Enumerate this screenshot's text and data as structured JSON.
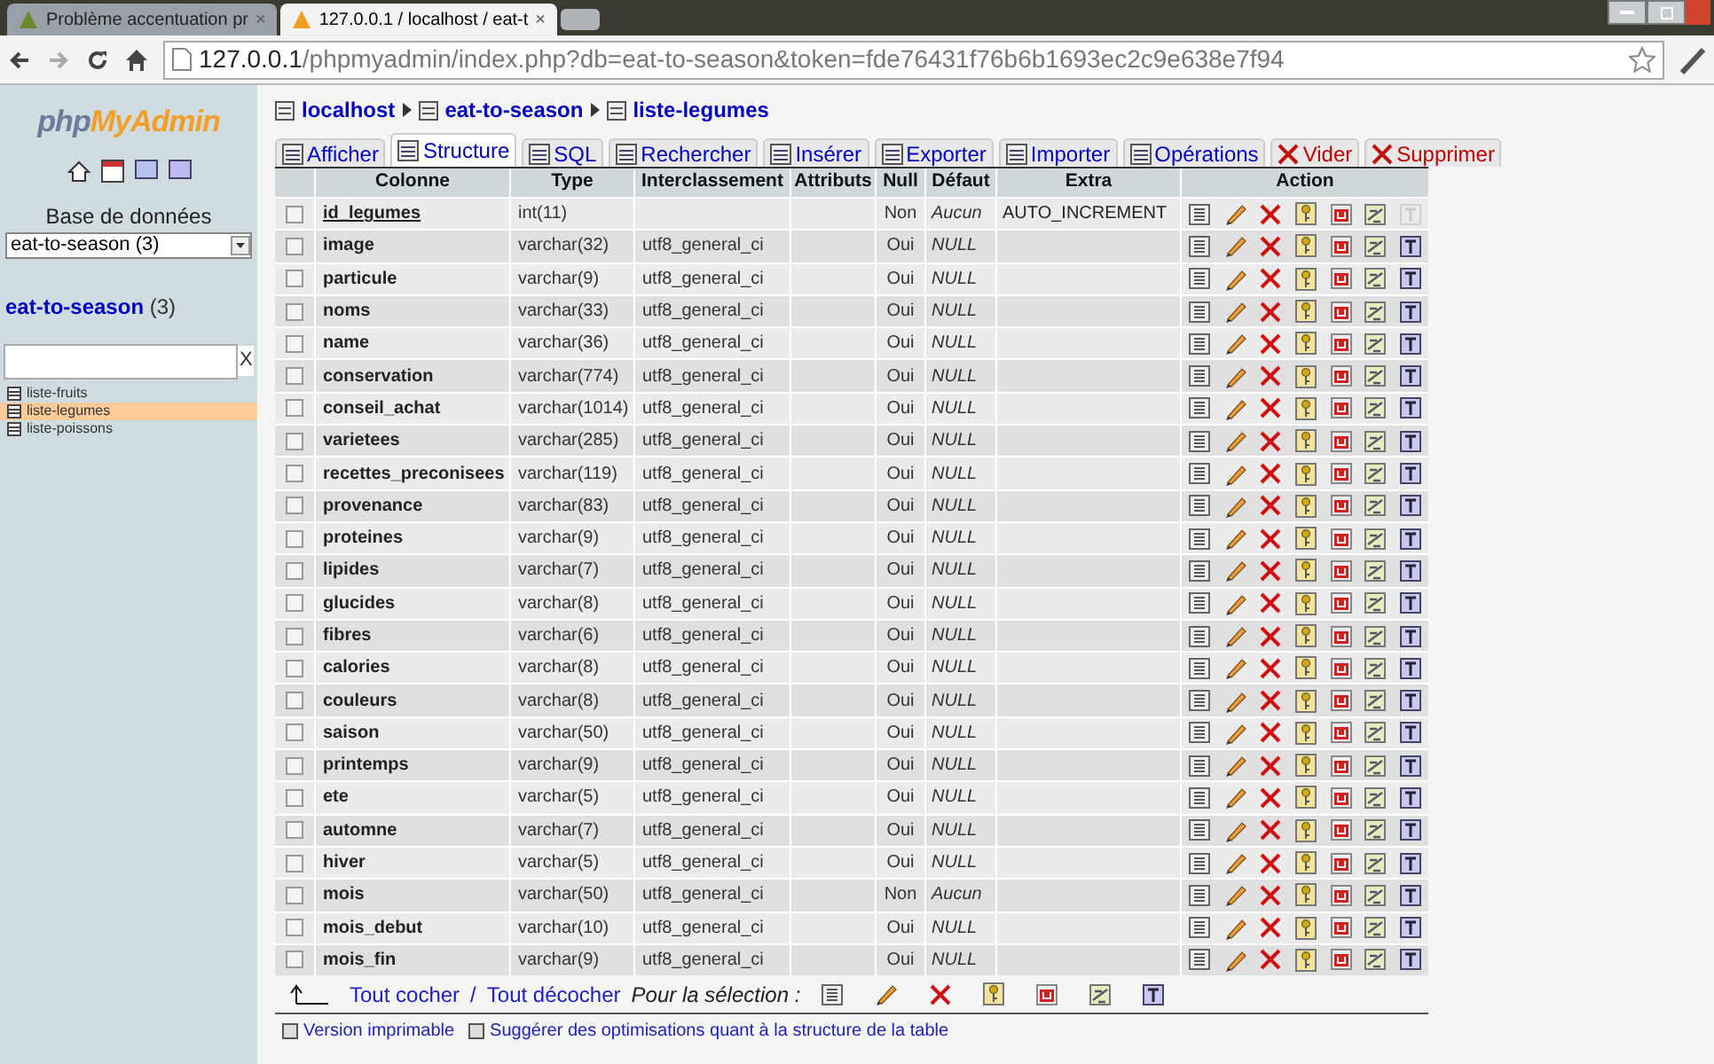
{
  "browser": {
    "tabs": [
      {
        "title": "Problème accentuation pr",
        "selected": false,
        "close": "×"
      },
      {
        "title": "127.0.0.1 / localhost / eat-t",
        "selected": true,
        "close": "×"
      }
    ],
    "url": {
      "host": "127.0.0.1",
      "path": "/phpmyadmin/index.php?db=eat-to-season&token=fde76431f76b6b1693ec2c9e638e7f94"
    }
  },
  "sidebar": {
    "logo": {
      "part1": "php",
      "part2": "MyAdmin"
    },
    "db_label": "Base de données",
    "db_select": "eat-to-season (3)",
    "db_link": "eat-to-season",
    "db_count": "(3)",
    "filter_clear": "X",
    "tables": [
      {
        "name": "liste-fruits",
        "selected": false
      },
      {
        "name": "liste-legumes",
        "selected": true
      },
      {
        "name": "liste-poissons",
        "selected": false
      }
    ]
  },
  "breadcrumb": [
    "localhost",
    "eat-to-season",
    "liste-legumes"
  ],
  "tabs": [
    {
      "label": "Afficher",
      "selected": false,
      "kind": "normal"
    },
    {
      "label": "Structure",
      "selected": true,
      "kind": "normal"
    },
    {
      "label": "SQL",
      "selected": false,
      "kind": "normal"
    },
    {
      "label": "Rechercher",
      "selected": false,
      "kind": "normal"
    },
    {
      "label": "Insérer",
      "selected": false,
      "kind": "normal"
    },
    {
      "label": "Exporter",
      "selected": false,
      "kind": "normal"
    },
    {
      "label": "Importer",
      "selected": false,
      "kind": "normal"
    },
    {
      "label": "Opérations",
      "selected": false,
      "kind": "normal"
    },
    {
      "label": "Vider",
      "selected": false,
      "kind": "danger"
    },
    {
      "label": "Supprimer",
      "selected": false,
      "kind": "danger"
    }
  ],
  "table": {
    "columns": [
      "Colonne",
      "Type",
      "Interclassement",
      "Attributs",
      "Null",
      "Défaut",
      "Extra",
      "Action"
    ],
    "rows": [
      {
        "name": "id_legumes",
        "type": "int(11)",
        "collation": "",
        "null": "Non",
        "default": "Aucun",
        "extra": "AUTO_INCREMENT",
        "primary": true,
        "checked": false
      },
      {
        "name": "image",
        "type": "varchar(32)",
        "collation": "utf8_general_ci",
        "null": "Oui",
        "default": "NULL",
        "primary": false,
        "checked": false
      },
      {
        "name": "particule",
        "type": "varchar(9)",
        "collation": "utf8_general_ci",
        "null": "Oui",
        "default": "NULL",
        "primary": false,
        "checked": false
      },
      {
        "name": "noms",
        "type": "varchar(33)",
        "collation": "utf8_general_ci",
        "null": "Oui",
        "default": "NULL",
        "primary": false,
        "checked": false
      },
      {
        "name": "name",
        "type": "varchar(36)",
        "collation": "utf8_general_ci",
        "null": "Oui",
        "default": "NULL",
        "primary": false,
        "checked": false
      },
      {
        "name": "conservation",
        "type": "varchar(774)",
        "collation": "utf8_general_ci",
        "null": "Oui",
        "default": "NULL",
        "primary": false,
        "checked": false
      },
      {
        "name": "conseil_achat",
        "type": "varchar(1014)",
        "collation": "utf8_general_ci",
        "null": "Oui",
        "default": "NULL",
        "primary": false,
        "checked": false
      },
      {
        "name": "varietees",
        "type": "varchar(285)",
        "collation": "utf8_general_ci",
        "null": "Oui",
        "default": "NULL",
        "primary": false,
        "checked": false
      },
      {
        "name": "recettes_preconisees",
        "type": "varchar(119)",
        "collation": "utf8_general_ci",
        "null": "Oui",
        "default": "NULL",
        "primary": false,
        "checked": false
      },
      {
        "name": "provenance",
        "type": "varchar(83)",
        "collation": "utf8_general_ci",
        "null": "Oui",
        "default": "NULL",
        "primary": false,
        "checked": false
      },
      {
        "name": "proteines",
        "type": "varchar(9)",
        "collation": "utf8_general_ci",
        "null": "Oui",
        "default": "NULL",
        "primary": false,
        "checked": false
      },
      {
        "name": "lipides",
        "type": "varchar(7)",
        "collation": "utf8_general_ci",
        "null": "Oui",
        "default": "NULL",
        "primary": false,
        "checked": false
      },
      {
        "name": "glucides",
        "type": "varchar(8)",
        "collation": "utf8_general_ci",
        "null": "Oui",
        "default": "NULL",
        "primary": false,
        "checked": false
      },
      {
        "name": "fibres",
        "type": "varchar(6)",
        "collation": "utf8_general_ci",
        "null": "Oui",
        "default": "NULL",
        "primary": false,
        "checked": false
      },
      {
        "name": "calories",
        "type": "varchar(8)",
        "collation": "utf8_general_ci",
        "null": "Oui",
        "default": "NULL",
        "primary": false,
        "checked": false
      },
      {
        "name": "couleurs",
        "type": "varchar(8)",
        "collation": "utf8_general_ci",
        "null": "Oui",
        "default": "NULL",
        "primary": false,
        "checked": false
      },
      {
        "name": "saison",
        "type": "varchar(50)",
        "collation": "utf8_general_ci",
        "null": "Oui",
        "default": "NULL",
        "primary": false,
        "checked": false
      },
      {
        "name": "printemps",
        "type": "varchar(9)",
        "collation": "utf8_general_ci",
        "null": "Oui",
        "default": "NULL",
        "primary": false,
        "checked": false
      },
      {
        "name": "ete",
        "type": "varchar(5)",
        "collation": "utf8_general_ci",
        "null": "Oui",
        "default": "NULL",
        "primary": false,
        "checked": false
      },
      {
        "name": "automne",
        "type": "varchar(7)",
        "collation": "utf8_general_ci",
        "null": "Oui",
        "default": "NULL",
        "primary": false,
        "checked": false
      },
      {
        "name": "hiver",
        "type": "varchar(5)",
        "collation": "utf8_general_ci",
        "null": "Oui",
        "default": "NULL",
        "primary": false,
        "checked": false
      },
      {
        "name": "mois",
        "type": "varchar(50)",
        "collation": "utf8_general_ci",
        "null": "Non",
        "default": "Aucun",
        "primary": false,
        "checked": false
      },
      {
        "name": "mois_debut",
        "type": "varchar(10)",
        "collation": "utf8_general_ci",
        "null": "Oui",
        "default": "NULL",
        "primary": false,
        "checked": false
      },
      {
        "name": "mois_fin",
        "type": "varchar(9)",
        "collation": "utf8_general_ci",
        "null": "Oui",
        "default": "NULL",
        "primary": false,
        "checked": false
      }
    ]
  },
  "footer": {
    "check_all": "Tout cocher",
    "separator": "/",
    "uncheck_all": "Tout décocher",
    "with_selected": "Pour la sélection :"
  },
  "bottom_links": [
    "Version imprimable",
    "Suggérer des optimisations quant à la structure de la table"
  ]
}
